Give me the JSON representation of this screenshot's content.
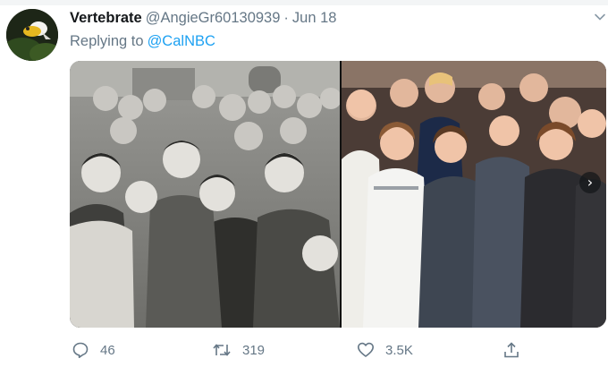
{
  "tweet": {
    "display_name": "Vertebrate",
    "handle": "@AngieGr60130939",
    "separator": "·",
    "date": "Jun 18",
    "reply_label": "Replying to",
    "reply_mention": "@CalNBC"
  },
  "actions": {
    "replies": "46",
    "retweets": "319",
    "likes": "3.5K"
  },
  "colors": {
    "link": "#1da1f2",
    "secondary_text": "#657786",
    "primary_text": "#14171a"
  },
  "icons": [
    "caret-down-icon",
    "reply-icon",
    "retweet-icon",
    "like-icon",
    "share-icon",
    "chevron-right-icon"
  ]
}
